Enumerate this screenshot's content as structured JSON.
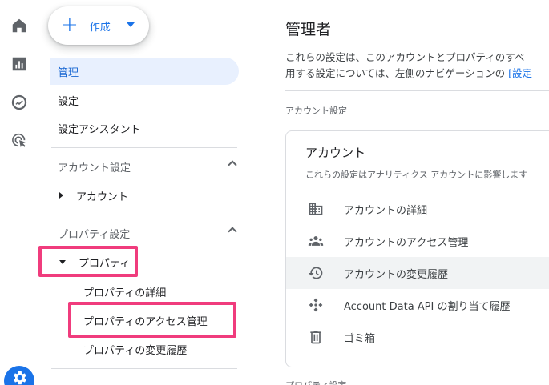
{
  "rail": {
    "icons": [
      "home-icon",
      "reports-icon",
      "explore-icon",
      "advertising-icon",
      "settings-gear-icon"
    ]
  },
  "sidebar": {
    "create_label": "作成",
    "items": [
      {
        "label": "管理"
      },
      {
        "label": "設定"
      },
      {
        "label": "設定アシスタント"
      }
    ],
    "account_section": {
      "heading": "アカウント設定",
      "item": "アカウント"
    },
    "property_section": {
      "heading": "プロパティ設定",
      "item": "プロパティ",
      "sub_items": [
        {
          "label": "プロパティの詳細"
        },
        {
          "label": "プロパティのアクセス管理"
        },
        {
          "label": "プロパティの変更履歴"
        }
      ]
    },
    "highlight_color": "#f03c7d",
    "active_bg": "#e8f0fe"
  },
  "main": {
    "title": "管理者",
    "description_line1": "これらの設定は、このアカウントとプロパティのすべ",
    "description_line2_prefix": "用する設定については、左側のナビゲーションの ",
    "description_link": "[設定",
    "account_settings_label": "アカウント設定",
    "card": {
      "title": "アカウント",
      "subtitle": "これらの設定はアナリティクス アカウントに影響します",
      "rows": [
        {
          "icon": "building-icon",
          "label": "アカウントの詳細"
        },
        {
          "icon": "group-icon",
          "label": "アカウントのアクセス管理"
        },
        {
          "icon": "history-icon",
          "label": "アカウントの変更履歴"
        },
        {
          "icon": "api-icon",
          "label": "Account Data API の割り当て履歴"
        },
        {
          "icon": "trash-icon",
          "label": "ゴミ箱"
        }
      ]
    },
    "property_settings_label": "プロパティ設定"
  },
  "colors": {
    "accent": "#1a73e8",
    "text": "#202124",
    "muted": "#5f6368"
  }
}
